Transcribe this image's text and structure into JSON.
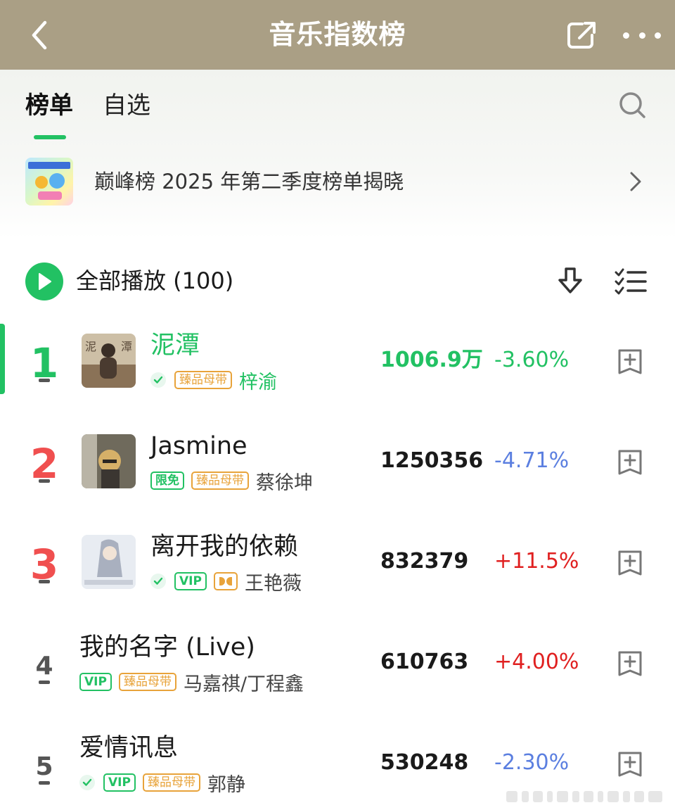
{
  "header": {
    "title": "音乐指数榜",
    "back_icon": "chevron-left-icon",
    "share_icon": "share-icon",
    "more_icon": "more-icon"
  },
  "tabs": [
    {
      "label": "榜单",
      "active": true
    },
    {
      "label": "自选",
      "active": false
    }
  ],
  "banner": {
    "text": "巅峰榜 2025 年第二季度榜单揭晓"
  },
  "play_all": {
    "label": "全部播放 (100)"
  },
  "songs": [
    {
      "rank": "1",
      "title": "泥潭",
      "artist": "梓渝",
      "verified": true,
      "tags": [
        "臻品母带"
      ],
      "score": "1006.9万",
      "change": "-3.60%",
      "active": true
    },
    {
      "rank": "2",
      "title": "Jasmine",
      "artist": "蔡徐坤",
      "verified": false,
      "tags": [
        "限免",
        "臻品母带"
      ],
      "score": "1250356",
      "change": "-4.71%",
      "active": false
    },
    {
      "rank": "3",
      "title": "离开我的依赖",
      "artist": "王艳薇",
      "verified": true,
      "tags": [
        "VIP",
        "dolby"
      ],
      "score": "832379",
      "change": "+11.5%",
      "active": false
    },
    {
      "rank": "4",
      "title": "我的名字 (Live)",
      "artist": "马嘉祺/丁程鑫",
      "verified": false,
      "tags": [
        "VIP",
        "臻品母带"
      ],
      "score": "610763",
      "change": "+4.00%",
      "active": false
    },
    {
      "rank": "5",
      "title": "爱情讯息",
      "artist": "郭静",
      "verified": true,
      "tags": [
        "VIP",
        "臻品母带"
      ],
      "score": "530248",
      "change": "-2.30%",
      "active": false
    }
  ],
  "colors": {
    "header": "#aa9f85",
    "accent": "#22c163",
    "rank_red": "#f04f4f",
    "up": "#e02020",
    "down": "#5b7fe0",
    "gold_tag": "#e8a33a"
  }
}
